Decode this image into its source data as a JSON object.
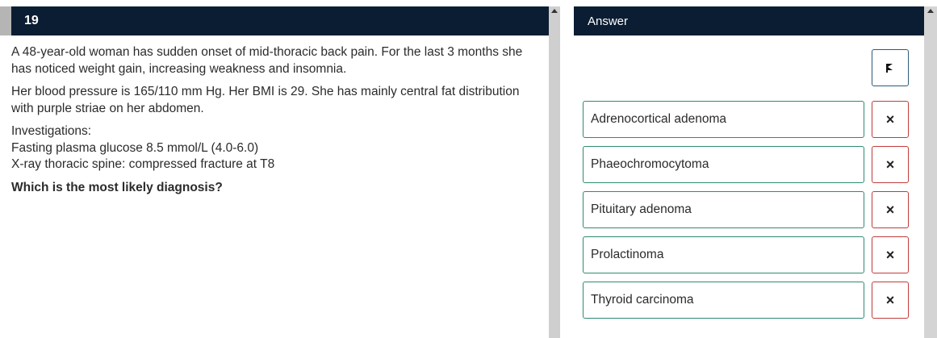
{
  "question": {
    "number": "19",
    "paragraphs": [
      "A 48-year-old woman has sudden onset of mid-thoracic back pain. For the last 3 months she has noticed weight gain, increasing weakness and insomnia.",
      "Her blood pressure is 165/110 mm Hg. Her BMI is 29. She has mainly central fat distribution with purple striae on her abdomen."
    ],
    "investigations_label": "Investigations:",
    "investigations": [
      "Fasting plasma glucose 8.5 mmol/L (4.0-6.0)",
      "X-ray thoracic spine: compressed fracture at T8"
    ],
    "prompt": "Which is the most likely diagnosis?"
  },
  "answer": {
    "title": "Answer",
    "flag_icon": "flag-icon",
    "options": [
      {
        "label": "Adrenocortical adenoma",
        "strike": "×"
      },
      {
        "label": "Phaeochromocytoma",
        "strike": "×"
      },
      {
        "label": "Pituitary adenoma",
        "strike": "×"
      },
      {
        "label": "Prolactinoma",
        "strike": "×"
      },
      {
        "label": "Thyroid carcinoma",
        "strike": "×"
      }
    ]
  },
  "colors": {
    "header_bg": "#0b1d33",
    "option_border": "#2f8a73",
    "strike_border": "#c23b3b",
    "flag_border": "#2a5c7a"
  }
}
